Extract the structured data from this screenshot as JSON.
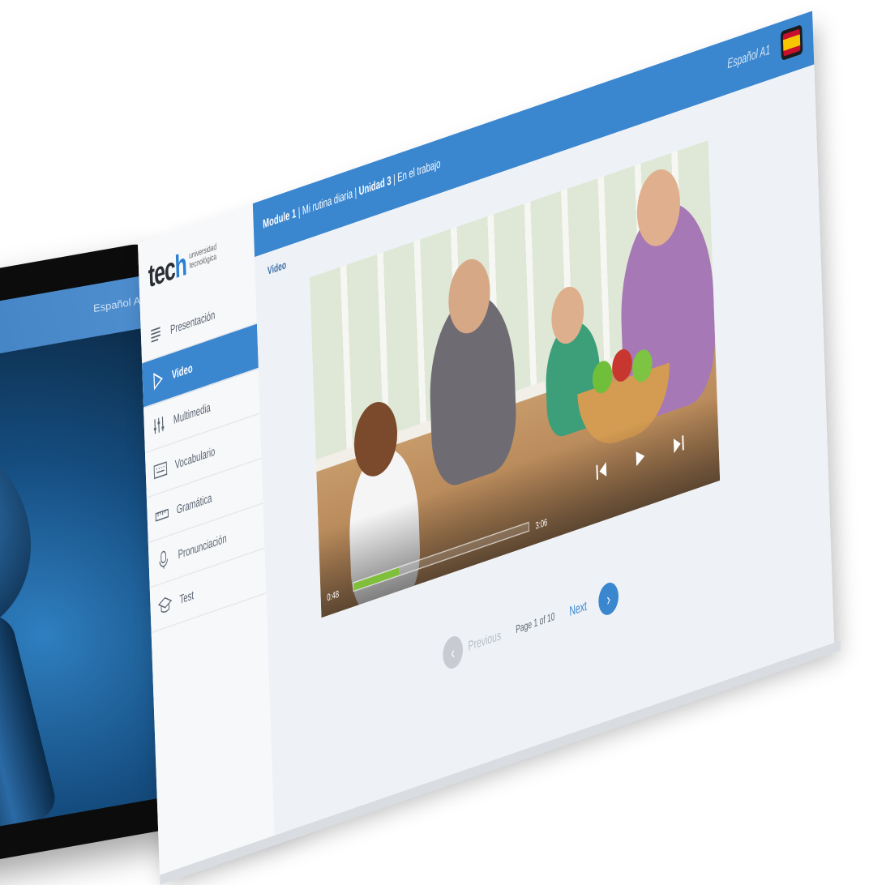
{
  "back_tablet": {
    "header_text": "Español A"
  },
  "logo": {
    "mark": "tec",
    "mark_h": "h",
    "subtitle": "universidad tecnológica"
  },
  "sidebar": {
    "items": [
      {
        "label": "Presentación",
        "icon": "list-icon"
      },
      {
        "label": "Video",
        "icon": "play-icon"
      },
      {
        "label": "Multimedia",
        "icon": "equalizer-icon"
      },
      {
        "label": "Vocabulario",
        "icon": "keyboard-icon"
      },
      {
        "label": "Gramática",
        "icon": "ruler-icon"
      },
      {
        "label": "Pronunciación",
        "icon": "microphone-icon"
      },
      {
        "label": "Test",
        "icon": "graduation-cap-icon"
      }
    ]
  },
  "header": {
    "module": "Module 1",
    "module_sub": "Mi rutina diaria",
    "unit": "Unidad 3",
    "unit_sub": "En el trabajo",
    "language": "Español A1",
    "flag": "spain-flag-icon"
  },
  "content": {
    "section_title": "Video"
  },
  "player": {
    "current_time": "0:48",
    "total_time": "3:06",
    "progress_fraction": 0.26
  },
  "pager": {
    "previous_label": "Previous",
    "page_info": "Page 1 of 10",
    "next_label": "Next"
  },
  "colors": {
    "accent": "#3a86cf",
    "progress": "#7fbf3a"
  }
}
